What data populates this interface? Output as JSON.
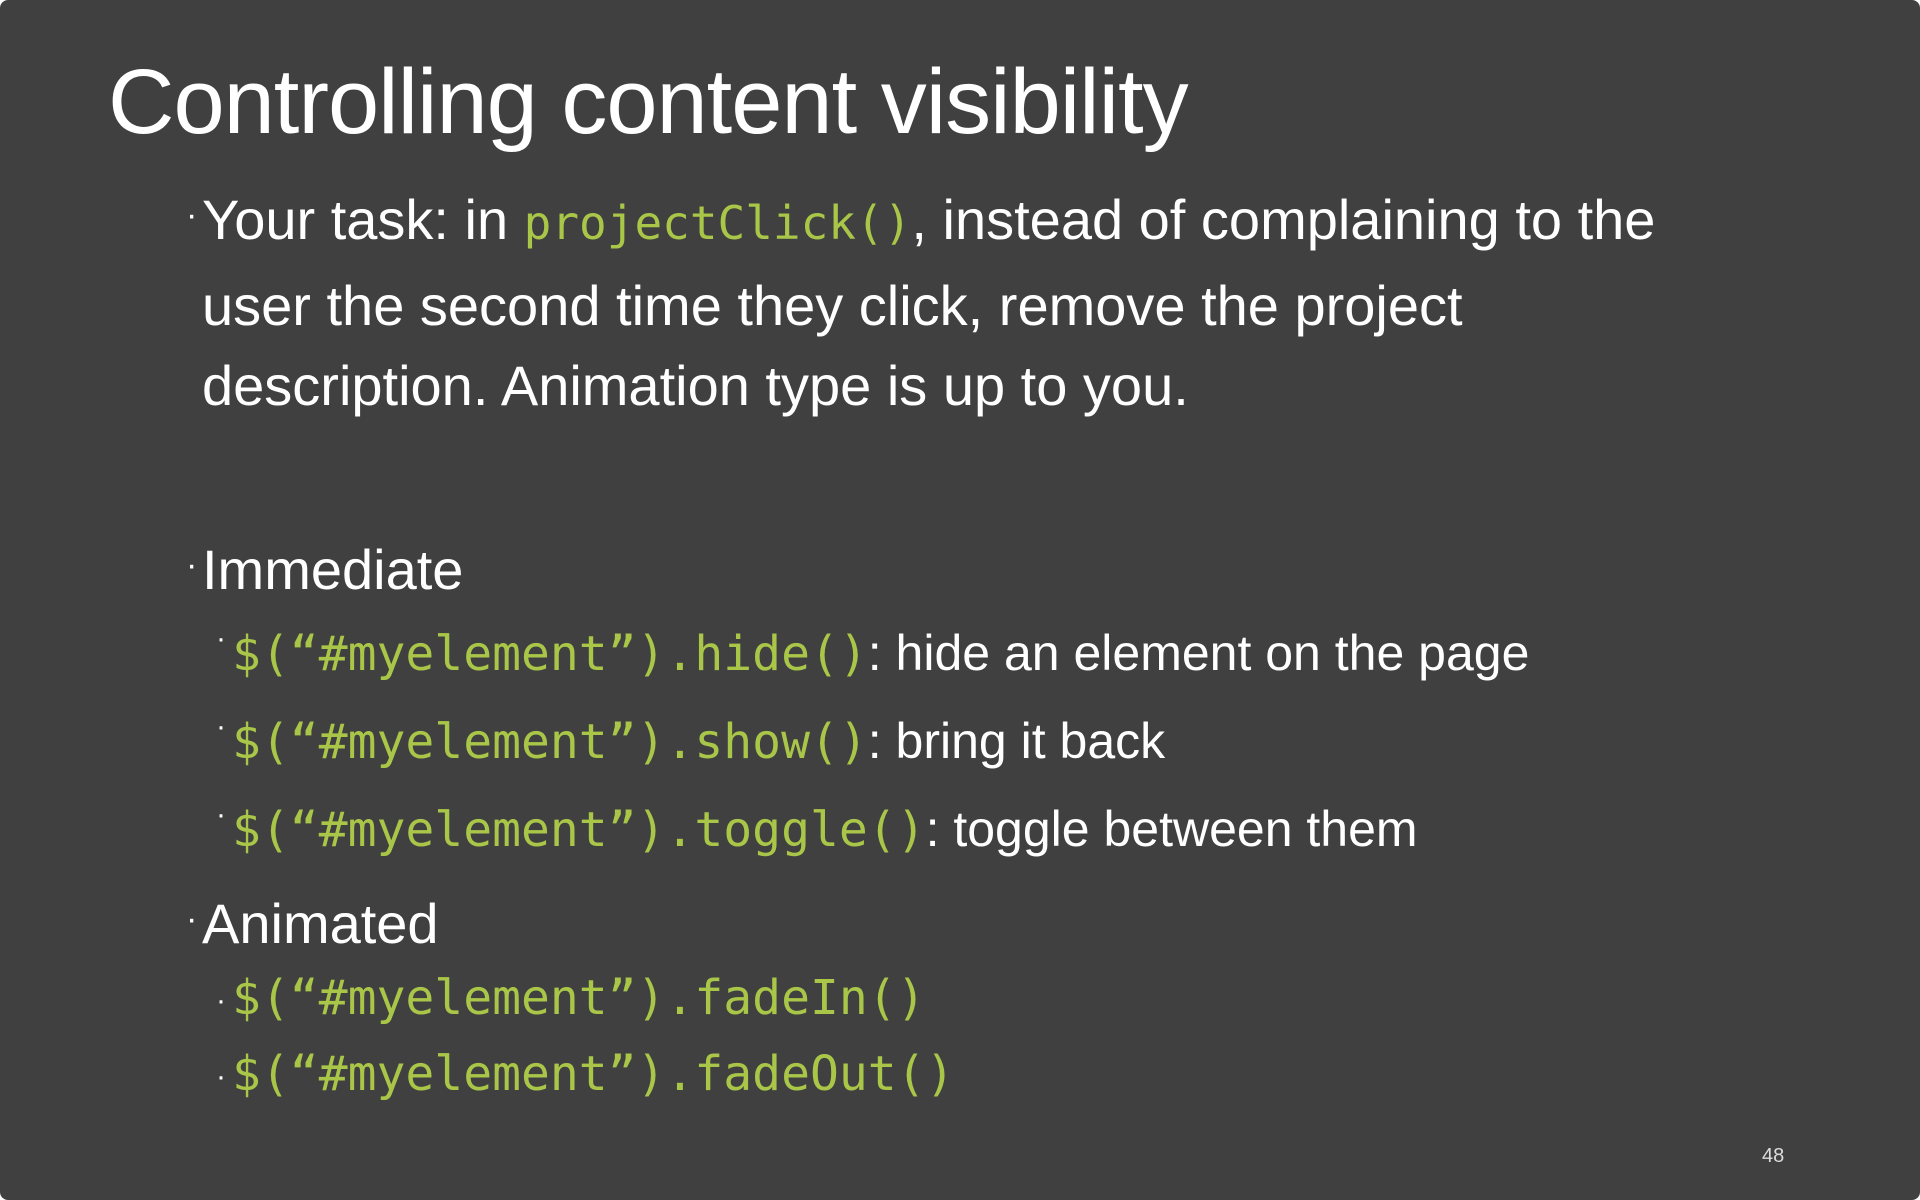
{
  "slide": {
    "title": "Controlling content visibility",
    "bullet_glyph": "·",
    "task": {
      "line1_prefix": "Your task: in ",
      "line1_code": "projectClick()",
      "line1_suffix": ", instead of complaining to the",
      "line2": "user the second time they click, remove the project",
      "line3": "description.  Animation type is up to you."
    },
    "immediate": {
      "heading": "Immediate",
      "items": [
        {
          "code": "$(“#myelement”).hide()",
          "desc": ": hide an element on the page"
        },
        {
          "code": "$(“#myelement”).show()",
          "desc": ": bring it back"
        },
        {
          "code": "$(“#myelement”).toggle()",
          "desc": ": toggle between them"
        }
      ]
    },
    "animated": {
      "heading": "Animated",
      "items": [
        {
          "code": "$(“#myelement”).fadeIn()"
        },
        {
          "code": "$(“#myelement”).fadeOut()"
        }
      ]
    },
    "page_number": "48",
    "colors": {
      "background": "#404040",
      "text": "#ffffff",
      "code": "#a9c648"
    }
  }
}
